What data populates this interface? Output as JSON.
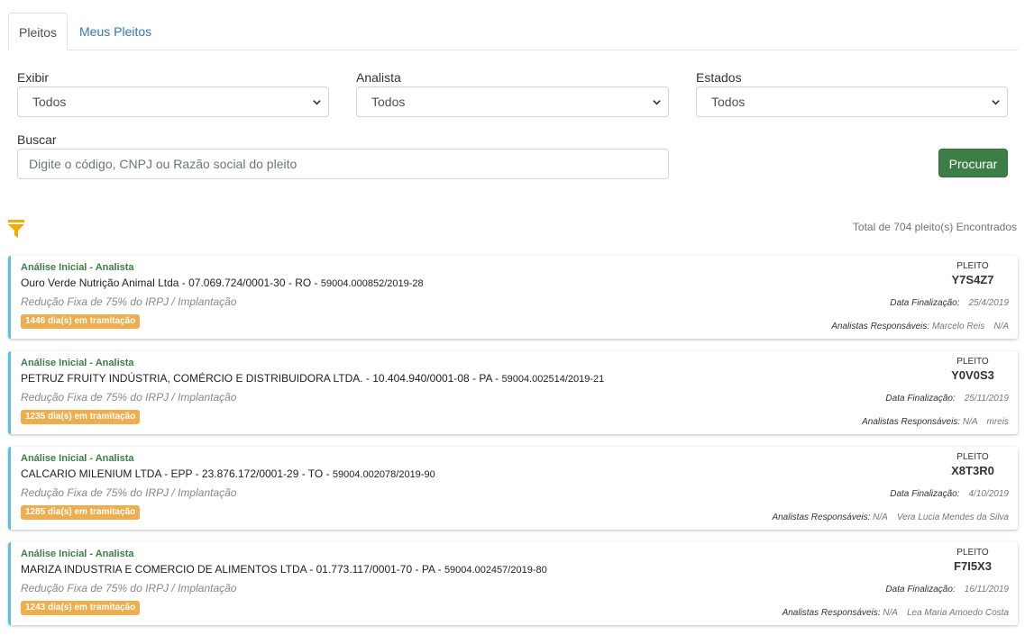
{
  "tabs": [
    {
      "label": "Pleitos",
      "active": true
    },
    {
      "label": "Meus Pleitos",
      "active": false
    }
  ],
  "filters": {
    "exibir": {
      "label": "Exibir",
      "value": "Todos"
    },
    "analista": {
      "label": "Analista",
      "value": "Todos"
    },
    "estados": {
      "label": "Estados",
      "value": "Todos"
    },
    "buscar": {
      "label": "Buscar",
      "placeholder": "Digite o código, CNPJ ou Razão social do pleito",
      "value": ""
    }
  },
  "search_button": "Procurar",
  "filter_icon": "funnel-icon",
  "total_text": "Total de 704 pleito(s) Encontrados",
  "labels": {
    "pleito": "PLEITO",
    "data_finalizacao": "Data Finalização:",
    "analistas": "Analistas Responsáveis:"
  },
  "colors": {
    "accent_green": "#3c7e45",
    "card_border": "#5bc0de",
    "badge": "#f0ad4e",
    "filter_icon": "#f0ad00"
  },
  "cards": [
    {
      "status": "Análise Inicial - Analista",
      "company": "Ouro Verde Nutrição Animal Ltda - 07.069.724/0001-30 - RO - ",
      "process": "59004.000852/2019-28",
      "program": "Redução Fixa de 75% do IRPJ / Implantação",
      "badge": "1446 dia(s) em tramitação",
      "code": "Y7S4Z7",
      "data_finalizacao": "25/4/2019",
      "analyst_1": "Marcelo Reis",
      "analyst_2": "N/A"
    },
    {
      "status": "Análise Inicial - Analista",
      "company": "PETRUZ FRUITY INDÚSTRIA, COMÉRCIO E DISTRIBUIDORA LTDA. - 10.404.940/0001-08 - PA - ",
      "process": "59004.002514/2019-21",
      "program": "Redução Fixa de 75% do IRPJ / Implantação",
      "badge": "1235 dia(s) em tramitação",
      "code": "Y0V0S3",
      "data_finalizacao": "25/11/2019",
      "analyst_1": "N/A",
      "analyst_2": "mreis"
    },
    {
      "status": "Análise Inicial - Analista",
      "company": "CALCARIO MILENIUM LTDA - EPP - 23.876.172/0001-29 - TO - ",
      "process": "59004.002078/2019-90",
      "program": "Redução Fixa de 75% do IRPJ / Implantação",
      "badge": "1285 dia(s) em tramitação",
      "code": "X8T3R0",
      "data_finalizacao": "4/10/2019",
      "analyst_1": "N/A",
      "analyst_2": "Vera Lucia Mendes da Silva"
    },
    {
      "status": "Análise Inicial - Analista",
      "company": "MARIZA INDUSTRIA E COMERCIO DE ALIMENTOS LTDA - 01.773.117/0001-70 - PA - ",
      "process": "59004.002457/2019-80",
      "program": "Redução Fixa de 75% do IRPJ / Implantação",
      "badge": "1243 dia(s) em tramitação",
      "code": "F7I5X3",
      "data_finalizacao": "16/11/2019",
      "analyst_1": "N/A",
      "analyst_2": "Lea Maria Amoedo Costa"
    }
  ]
}
